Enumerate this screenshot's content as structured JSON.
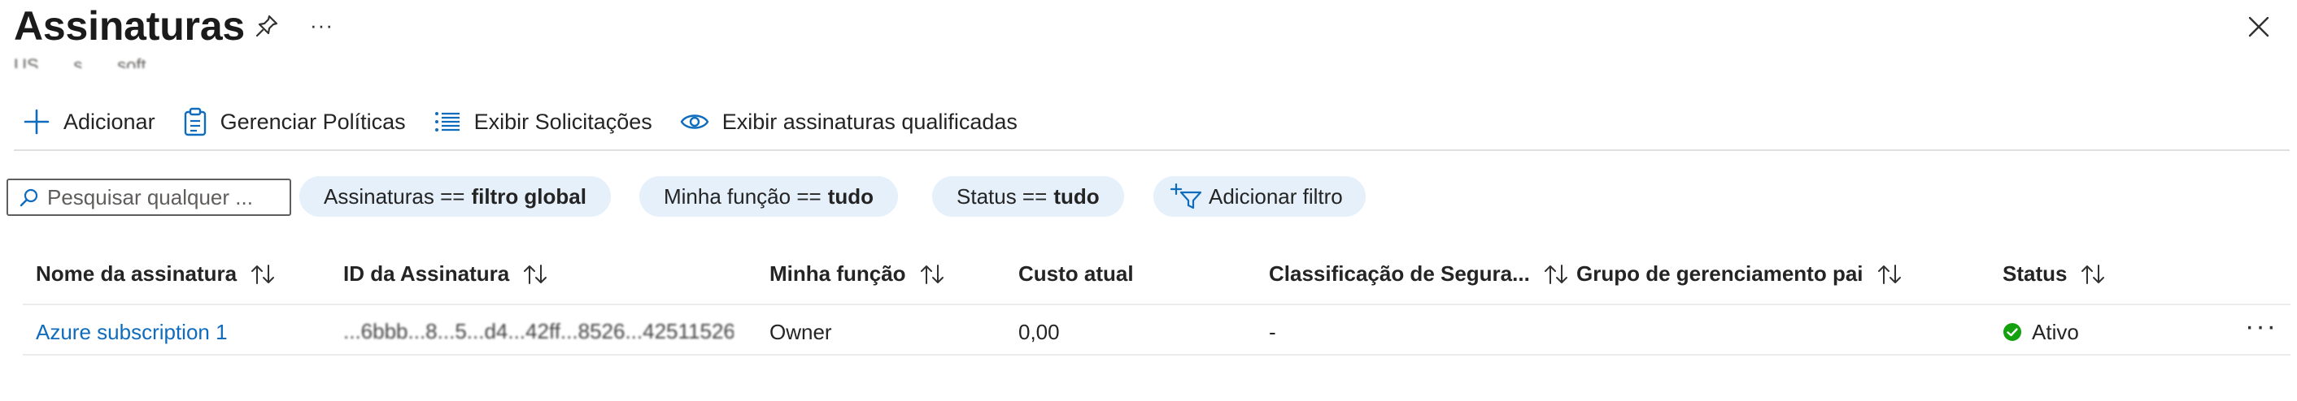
{
  "header": {
    "title": "Assinaturas",
    "subtitle": "US... ...s... ...soft...",
    "more_label": "···"
  },
  "toolbar": {
    "add_label": "Adicionar",
    "manage_policies_label": "Gerenciar Políticas",
    "view_requests_label": "Exibir Solicitações",
    "view_qualified_label": "Exibir assinaturas qualificadas"
  },
  "filters": {
    "search_placeholder": "Pesquisar qualquer ...",
    "pill_subscriptions_prefix": "Assinaturas ==",
    "pill_subscriptions_value": "filtro global",
    "pill_role_prefix": "Minha função ==",
    "pill_role_value": "tudo",
    "pill_status_prefix": "Status ==",
    "pill_status_value": "tudo",
    "add_filter_label": "Adicionar filtro"
  },
  "table": {
    "columns": [
      "Nome da assinatura",
      "ID da Assinatura",
      "Minha função",
      "Custo atual",
      "Classificação de Segura...",
      "Grupo de gerenciamento pai",
      "Status"
    ],
    "rows": [
      {
        "name": "Azure subscription 1",
        "id": "...6bbb...8...5...d4...42ff...8526...425115267...l48",
        "role": "Owner",
        "cost": "0,00",
        "secure_score": "-",
        "parent_group": "",
        "status": "Ativo"
      }
    ]
  },
  "colors": {
    "accent": "#0f6cbd",
    "pill_bg": "#e5f0fb",
    "status_ok": "#13a10e"
  },
  "icons": [
    "pin-icon",
    "more-icon",
    "close-icon",
    "plus-icon",
    "clipboard-icon",
    "list-icon",
    "eye-icon",
    "search-icon",
    "filter-add-icon",
    "sort-icon",
    "check-circle-icon"
  ]
}
